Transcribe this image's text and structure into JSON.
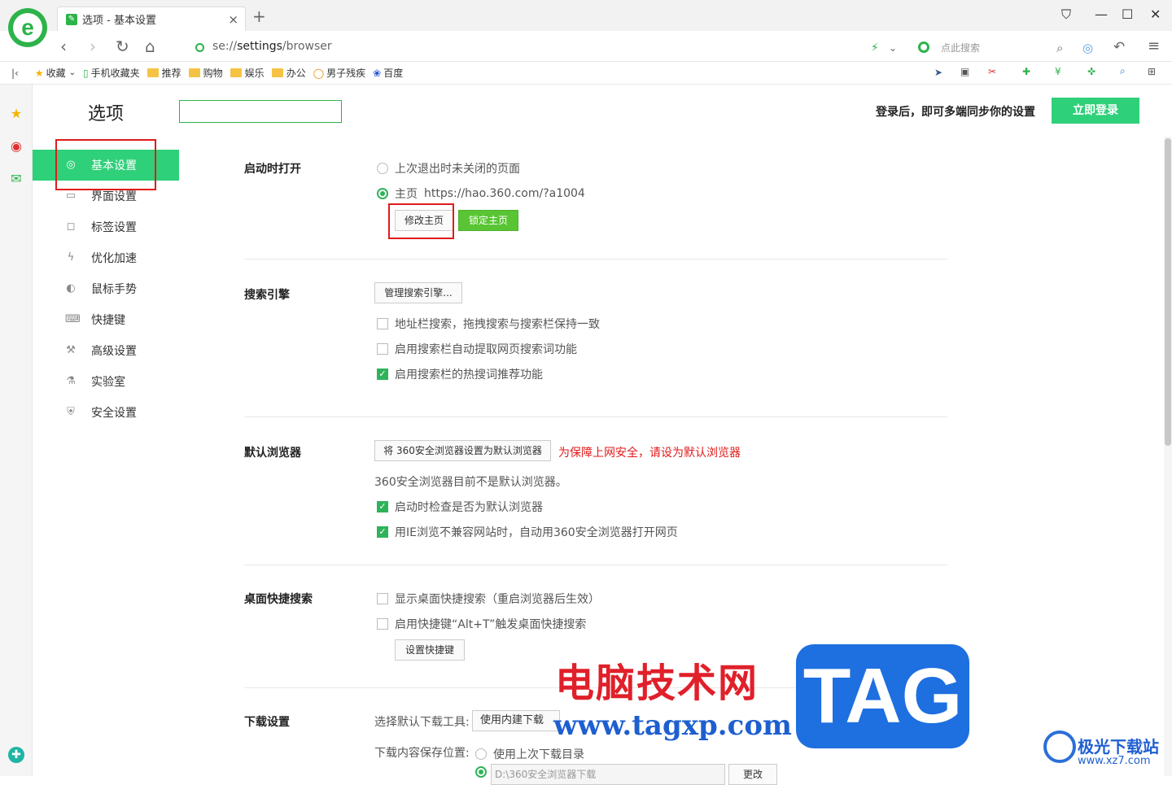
{
  "tab": {
    "title": "选项 - 基本设置",
    "close": "×",
    "new_tab": "+"
  },
  "addressbar": {
    "url_prefix": "se://",
    "url_bold": "settings",
    "url_suffix": "/browser",
    "search_placeholder": "点此搜索"
  },
  "bookmarks": [
    {
      "label": "收藏",
      "icon": "star-icon"
    },
    {
      "label": "手机收藏夹",
      "icon": "phone-icon"
    },
    {
      "label": "推荐",
      "icon": "folder-icon"
    },
    {
      "label": "购物",
      "icon": "folder-icon"
    },
    {
      "label": "娱乐",
      "icon": "folder-icon"
    },
    {
      "label": "办公",
      "icon": "folder-icon"
    },
    {
      "label": "男子残疾",
      "icon": "search-o-icon"
    },
    {
      "label": "百度",
      "icon": "paw-icon"
    }
  ],
  "page": {
    "title": "选项",
    "login_text": "登录后，即可多端同步你的设置",
    "login_button": "立即登录"
  },
  "nav": [
    {
      "label": "基本设置",
      "icon": "gear-icon",
      "active": true
    },
    {
      "label": "界面设置",
      "icon": "window-icon"
    },
    {
      "label": "标签设置",
      "icon": "tag-icon"
    },
    {
      "label": "优化加速",
      "icon": "bolt-icon"
    },
    {
      "label": "鼠标手势",
      "icon": "mouse-icon"
    },
    {
      "label": "快捷键",
      "icon": "keyboard-icon"
    },
    {
      "label": "高级设置",
      "icon": "wrench-icon"
    },
    {
      "label": "实验室",
      "icon": "flask-icon"
    },
    {
      "label": "安全设置",
      "icon": "shield-icon"
    }
  ],
  "startup": {
    "title": "启动时打开",
    "opt_last": "上次退出时未关闭的页面",
    "opt_home": "主页",
    "home_url": "https://hao.360.com/?a1004",
    "btn_modify": "修改主页",
    "btn_lock": "锁定主页"
  },
  "search_engine": {
    "title": "搜索引擎",
    "btn_manage": "管理搜索引擎...",
    "opt1": "地址栏搜索，拖拽搜索与搜索栏保持一致",
    "opt2": "启用搜索栏自动提取网页搜索词功能",
    "opt3": "启用搜索栏的热搜词推荐功能"
  },
  "default_browser": {
    "title": "默认浏览器",
    "btn_set": "将 360安全浏览器设置为默认浏览器",
    "warning": "为保障上网安全，请设为默认浏览器",
    "status": "360安全浏览器目前不是默认浏览器。",
    "opt1": "启动时检查是否为默认浏览器",
    "opt2": "用IE浏览不兼容网站时，自动用360安全浏览器打开网页"
  },
  "desktop_search": {
    "title": "桌面快捷搜索",
    "opt1": "显示桌面快捷搜索（重启浏览器后生效）",
    "opt2": "启用快捷键“Alt+T”触发桌面快捷搜索",
    "btn_hotkey": "设置快捷键"
  },
  "download": {
    "title": "下载设置",
    "tool_label": "选择默认下载工具:",
    "tool_value": "使用内建下载",
    "save_label": "下载内容保存位置:",
    "opt_last": "使用上次下载目录",
    "path": "D:\\360安全浏览器下载",
    "btn_change": "更改"
  },
  "watermark": {
    "cn": "电脑技术网",
    "url": "www.tagxp.com",
    "tag": "TAG",
    "site": "极光下载站",
    "site_url": "www.xz7.com"
  },
  "colors": {
    "accent": "#2fd07a",
    "highlight_box": "#e01b1b"
  }
}
